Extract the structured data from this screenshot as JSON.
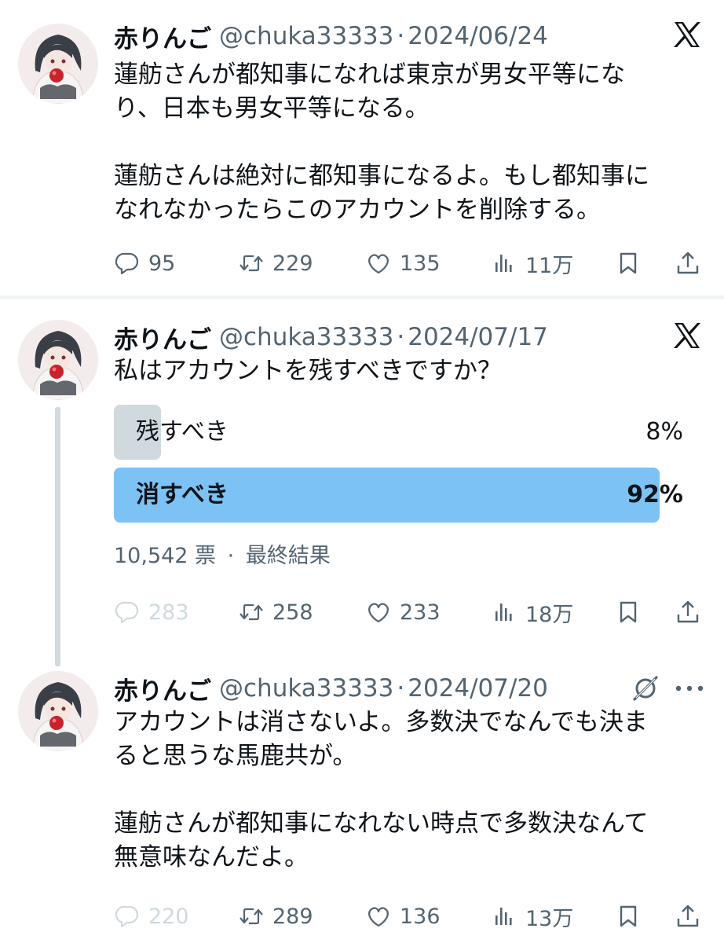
{
  "tweets": [
    {
      "name": "赤りんご",
      "handle": "@chuka33333",
      "separator": "·",
      "date": "2024/06/24",
      "badge_icon": "x-logo-icon",
      "lines": [
        "蓮舫さんが都知事になれば東京が男女平等にな",
        "り、日本も男女平等になる。",
        "",
        "蓮舫さんは絶対に都知事になるよ。もし都知事に",
        "なれなかったらこのアカウントを削除する。"
      ],
      "stats": {
        "replies": "95",
        "reposts": "229",
        "likes": "135",
        "views": "11万"
      }
    },
    {
      "name": "赤りんご",
      "handle": "@chuka33333",
      "separator": "·",
      "date": "2024/07/17",
      "badge_icon": "x-logo-icon",
      "lines": [
        "私はアカウントを残すべきですか？"
      ],
      "poll": {
        "options": [
          {
            "label": "残すべき",
            "percent_text": "8%",
            "fraction": 0.08,
            "color": "#cfd9de",
            "winner": false
          },
          {
            "label": "消すべき",
            "percent_text": "92%",
            "fraction": 0.92,
            "color": "#7cc2f5",
            "winner": true
          }
        ],
        "votes": "10,542 票",
        "separator": "·",
        "status": "最終結果"
      },
      "stats": {
        "replies": "283",
        "reposts": "258",
        "likes": "233",
        "views": "18万"
      }
    },
    {
      "name": "赤りんご",
      "handle": "@chuka33333",
      "separator": "·",
      "date": "2024/07/20",
      "badge_icon": "grok-icon",
      "lines": [
        "アカウントは消さないよ。多数決でなんでも決ま",
        "ると思うな馬鹿共が。",
        "",
        "蓮舫さんが都知事になれない時点で多数決なんて",
        "無意味なんだよ。"
      ],
      "stats": {
        "replies": "220",
        "reposts": "289",
        "likes": "136",
        "views": "13万"
      }
    }
  ],
  "colors": {
    "text": "#0f1419",
    "muted": "#536471",
    "dim": "#cfd9de",
    "poll_winner": "#7cc2f5",
    "poll_other": "#cfd9de"
  }
}
